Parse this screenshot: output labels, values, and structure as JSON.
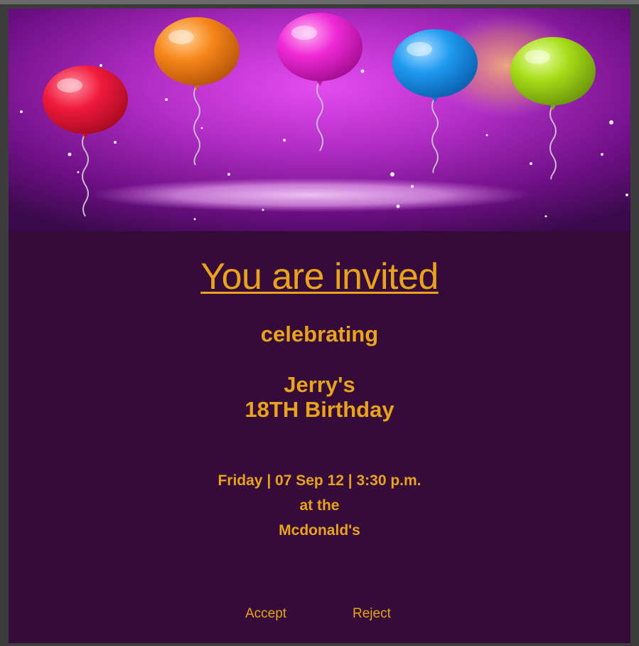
{
  "invitation": {
    "heading": "You are invited",
    "subheading": "celebrating",
    "honoree_line": "Jerry's",
    "occasion_line": "18TH Birthday",
    "datetime_line": "Friday | 07 Sep 12 | 3:30 p.m.",
    "venue_prefix": "at the",
    "venue": "Mcdonald's"
  },
  "actions": {
    "accept_label": "Accept",
    "reject_label": "Reject"
  },
  "colors": {
    "text_accent": "#e8a21c",
    "card_background": "#350b39",
    "banner_purple": "#b52fc9"
  },
  "banner": {
    "icon": "balloons-illustration",
    "balloon_colors": [
      "#f01a3c",
      "#f7861a",
      "#ef2ad6",
      "#1e9af0",
      "#a7dc18"
    ]
  }
}
